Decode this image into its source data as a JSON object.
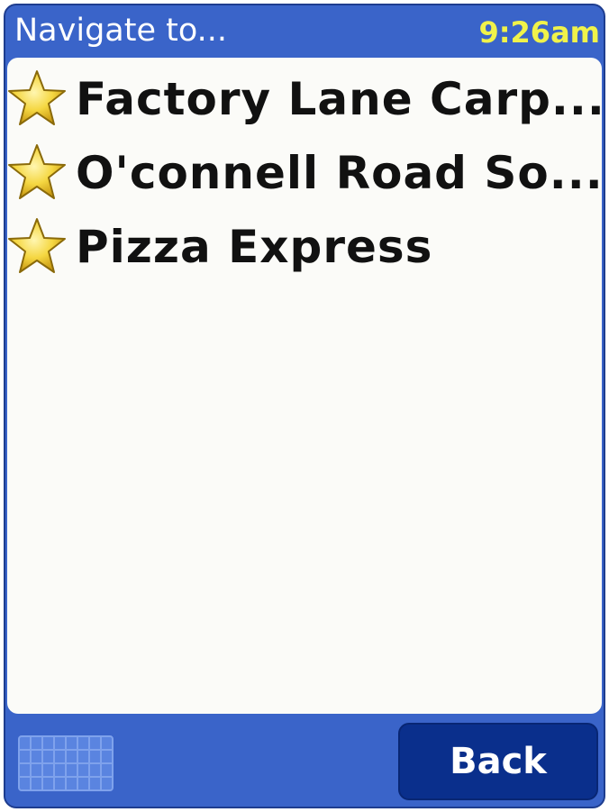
{
  "header": {
    "title": "Navigate to...",
    "time": "9:26am"
  },
  "favorites": {
    "icon": "star-icon",
    "items": [
      {
        "label": "Factory Lane Carp..."
      },
      {
        "label": "O'connell Road So..."
      },
      {
        "label": "Pizza Express"
      }
    ]
  },
  "footer": {
    "keyboard_icon": "keyboard-icon",
    "back_label": "Back"
  },
  "colors": {
    "frame_blue": "#3a64c9",
    "button_blue": "#0a2f8c",
    "clock_yellow": "#f0f24a",
    "star_yellow": "#f5d742",
    "list_background": "#fbfbf8"
  }
}
